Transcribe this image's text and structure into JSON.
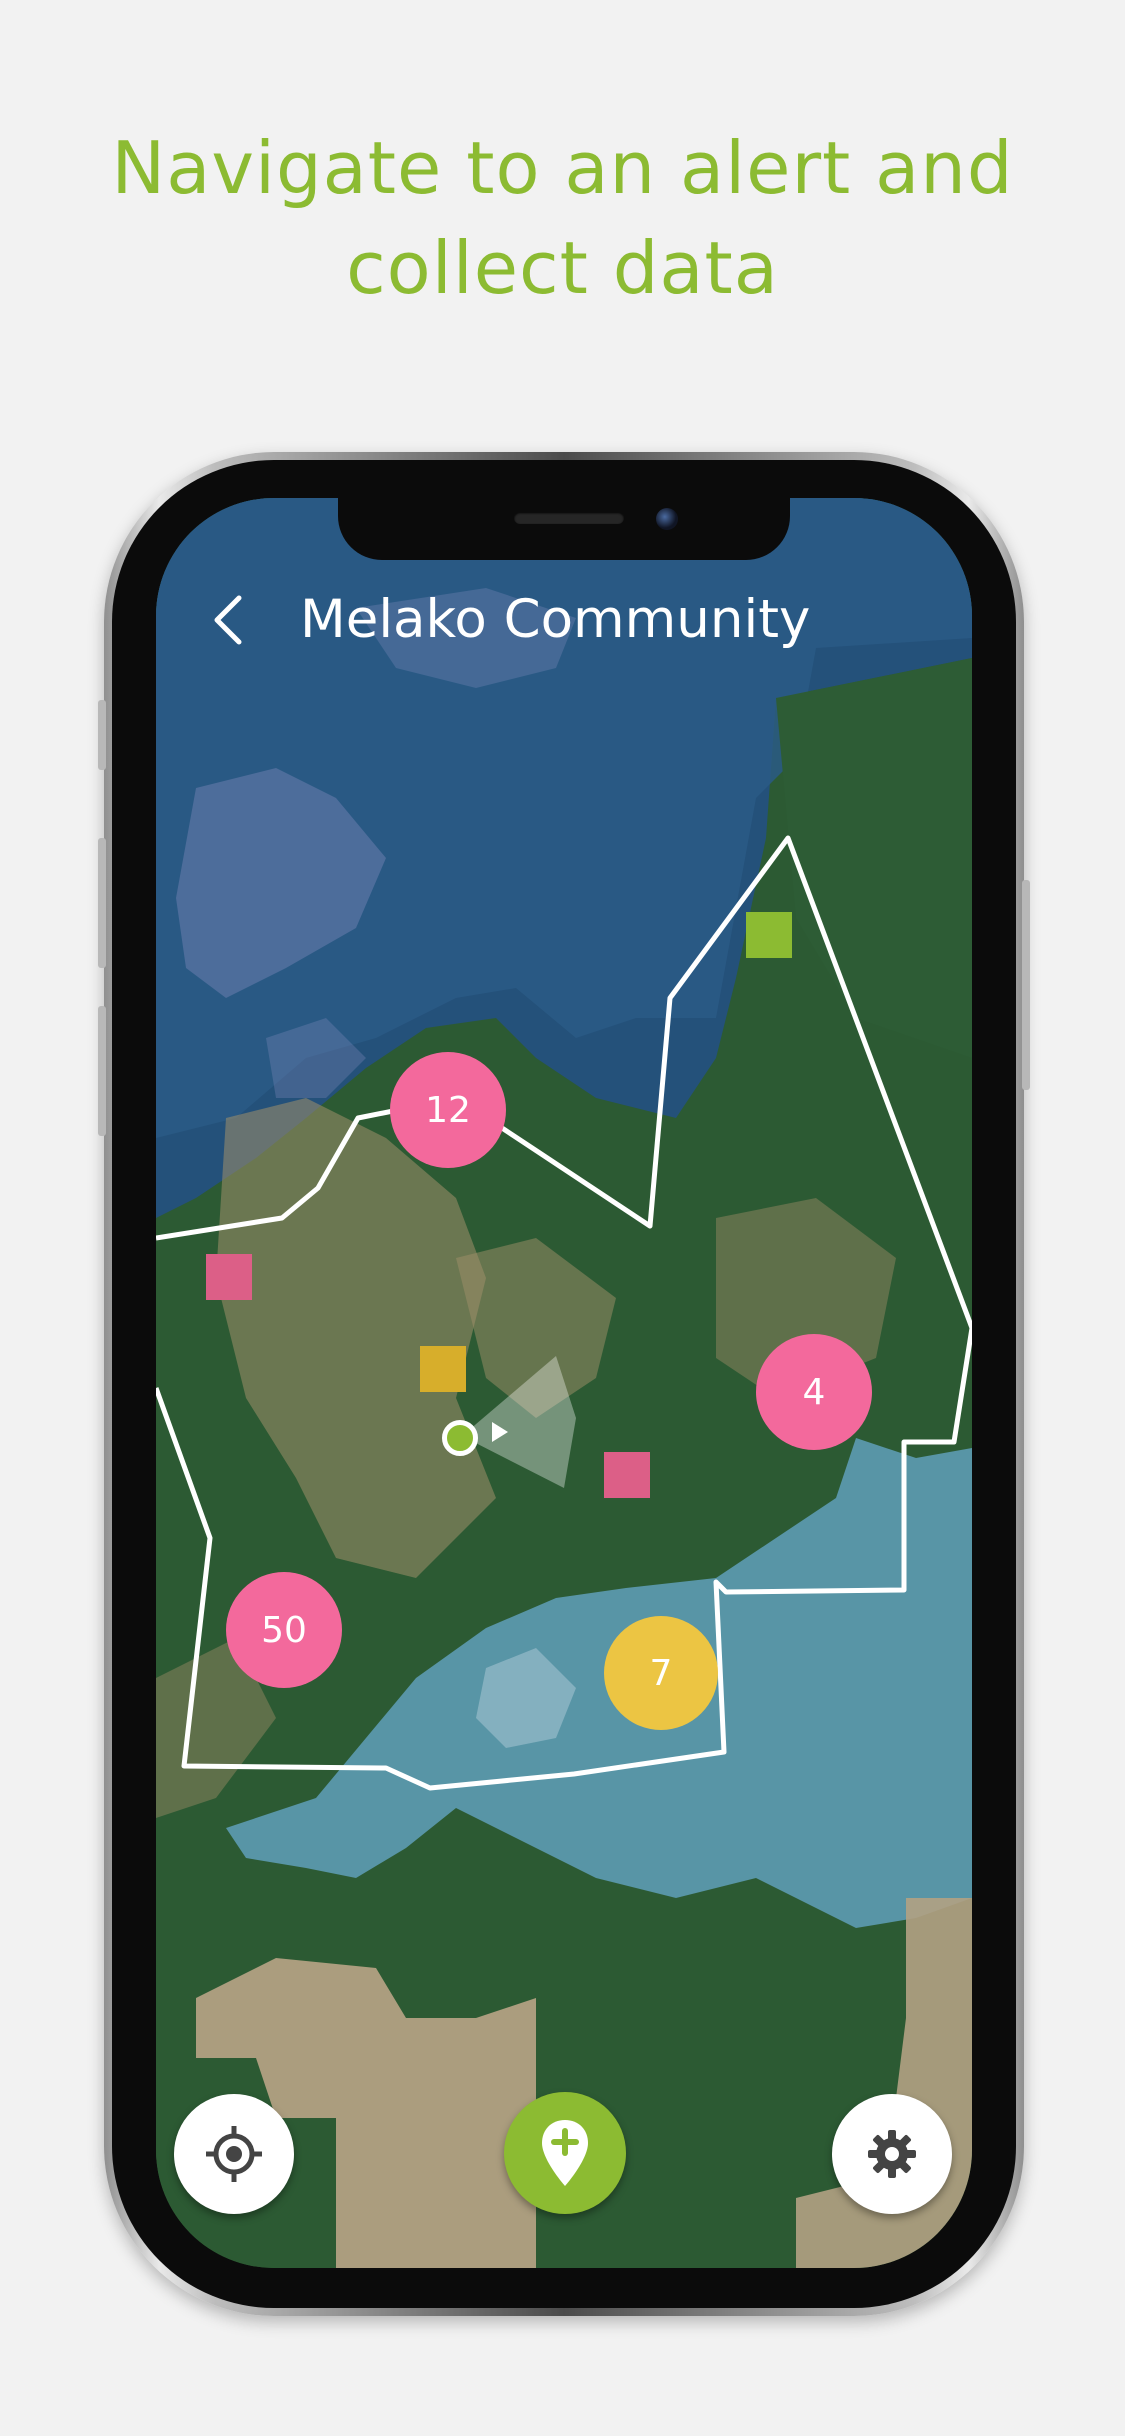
{
  "headline": {
    "line1": "Navigate to an alert and",
    "line2": "collect data"
  },
  "app": {
    "title": "Melako Community",
    "back_icon": "chevron-left-icon"
  },
  "clusters": [
    {
      "count": "12",
      "color": "#f3699c"
    },
    {
      "count": "4",
      "color": "#f3699c"
    },
    {
      "count": "50",
      "color": "#f3699c"
    },
    {
      "count": "7",
      "color": "#ecc543"
    }
  ],
  "alert_colors": {
    "pink": "#dc5f87",
    "yellow": "#d7ae2b",
    "green": "#8cbb32"
  },
  "buttons": {
    "locate_icon": "crosshair-icon",
    "add_icon": "map-pin-plus-icon",
    "settings_icon": "gear-icon"
  },
  "colors": {
    "accent": "#8cbb32",
    "alert_pink": "#f3699c",
    "alert_yellow": "#ecc543"
  }
}
